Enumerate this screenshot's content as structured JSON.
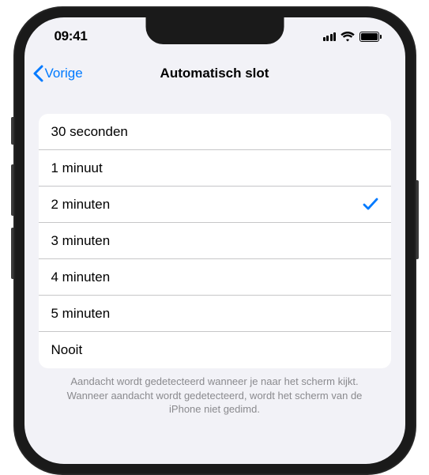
{
  "status": {
    "time": "09:41"
  },
  "nav": {
    "back_label": "Vorige",
    "title": "Automatisch slot"
  },
  "options": {
    "opt0": "30 seconden",
    "opt1": "1 minuut",
    "opt2": "2 minuten",
    "opt3": "3 minuten",
    "opt4": "4 minuten",
    "opt5": "5 minuten",
    "opt6": "Nooit"
  },
  "selected_index": 2,
  "footer": "Aandacht wordt gedetecteerd wanneer je naar het scherm kijkt. Wanneer aandacht wordt gedetecteerd, wordt het scherm van de iPhone niet gedimd.",
  "colors": {
    "accent": "#007aff",
    "background": "#f2f2f7"
  }
}
